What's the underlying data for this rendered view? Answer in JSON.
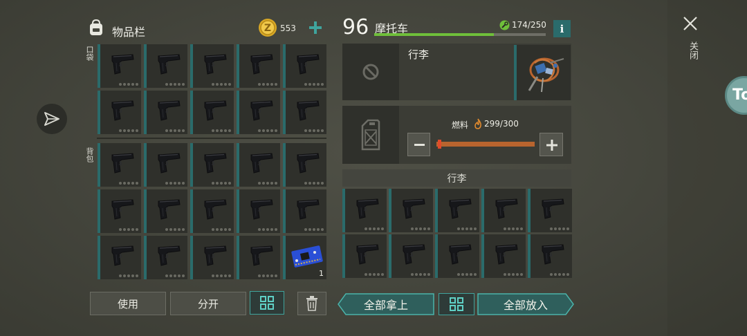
{
  "inventory": {
    "title": "物品栏",
    "coins": "553",
    "pocket_label": "口袋",
    "backpack_label": "背包"
  },
  "pocket_slots": [
    "pistol",
    "pistol",
    "pistol",
    "pistol",
    "pistol",
    "pistol",
    "pistol",
    "pistol",
    "pistol",
    "pistol"
  ],
  "backpack_slots": [
    "pistol",
    "pistol",
    "pistol",
    "pistol",
    "pistol",
    "pistol",
    "pistol",
    "pistol",
    "pistol",
    "pistol",
    "pistol",
    "pistol",
    "pistol",
    "pistol",
    "circuit-board"
  ],
  "backpack_last_qty": "1",
  "left_buttons": {
    "use": "使用",
    "split": "分开"
  },
  "vehicle": {
    "level": "96",
    "name": "摩托车",
    "durability": "174/250",
    "durability_fraction": 0.696,
    "info_label": "i",
    "luggage_title": "行李",
    "fuel_label": "燃料",
    "fuel_value": "299/300",
    "fuel_fraction": 0.997,
    "storage_title": "行李"
  },
  "storage_slots": [
    "pistol",
    "pistol",
    "pistol",
    "pistol",
    "pistol",
    "pistol",
    "pistol",
    "pistol",
    "pistol",
    "pistol"
  ],
  "right_buttons": {
    "take_all": "全部拿上",
    "put_all": "全部放入"
  },
  "close_label": "关闭",
  "side_bubble_text": "To",
  "colors": {
    "accent_teal": "#2a6b6b",
    "durability_green": "#6fbf3a",
    "fuel_orange": "#b8642e"
  }
}
